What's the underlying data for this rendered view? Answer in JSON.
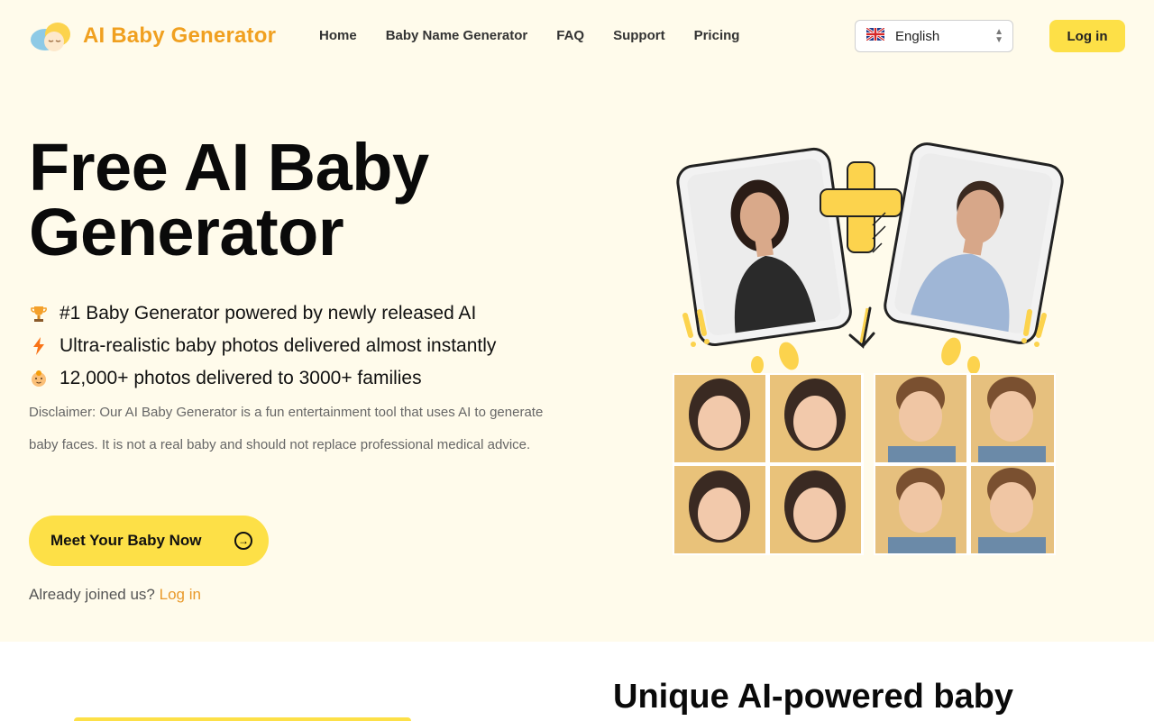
{
  "header": {
    "brand": "AI Baby Generator",
    "nav": [
      "Home",
      "Baby Name Generator",
      "FAQ",
      "Support",
      "Pricing"
    ],
    "language": "English",
    "login_label": "Log in"
  },
  "hero": {
    "title_line1": "Free AI Baby",
    "title_line2": "Generator",
    "features": [
      {
        "icon": "trophy-icon",
        "text": "#1 Baby Generator powered by newly released AI"
      },
      {
        "icon": "lightning-icon",
        "text": "Ultra-realistic baby photos delivered almost instantly"
      },
      {
        "icon": "baby-face-icon",
        "text": "12,000+ photos delivered to 3000+ families"
      }
    ],
    "disclaimer": "Disclaimer: Our AI Baby Generator is a fun entertainment tool that uses AI to generate baby faces. It is not a real baby and should not replace professional medical advice.",
    "cta_label": "Meet Your Baby Now",
    "joined_text": "Already joined us?",
    "joined_link": "Log in"
  },
  "section2": {
    "title": "Unique AI-powered baby"
  },
  "colors": {
    "accent": "#fde047",
    "brand": "#f0a020",
    "background": "#fffbeb"
  }
}
